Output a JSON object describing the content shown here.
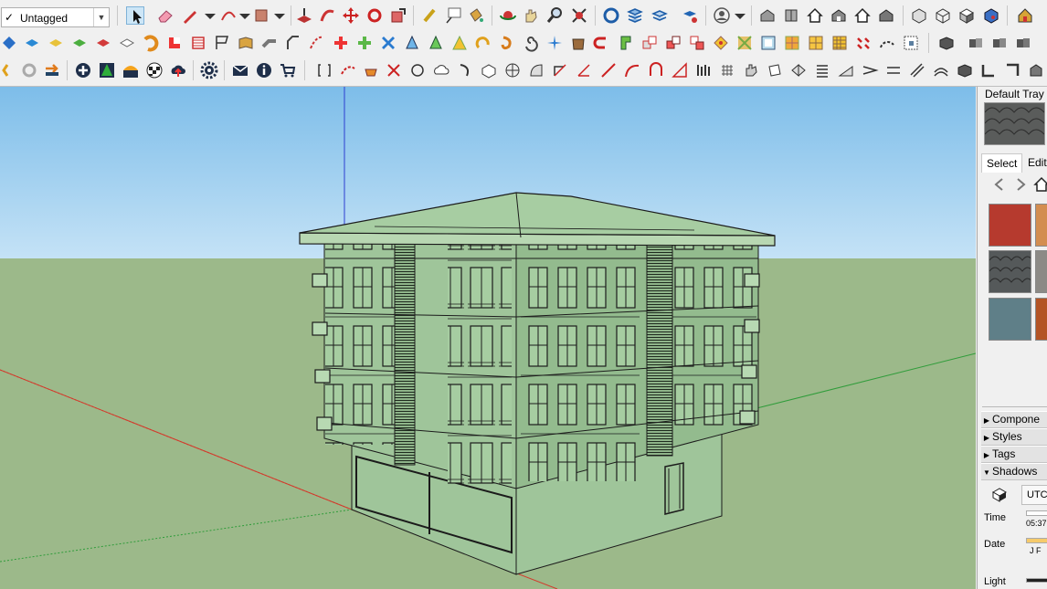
{
  "toolbar": {
    "tag_selector": {
      "checkmark": "✓",
      "value": "Untagged"
    }
  },
  "viewport": {
    "sky_color": "#a9d3ef",
    "ground_color": "#9cb98a",
    "model_color": "#9fc59a",
    "axis_colors": {
      "red": "#d33a2c",
      "green": "#2f9c3a",
      "blue": "#2d3ed0"
    }
  },
  "tray": {
    "title": "Default Tray",
    "tabs": {
      "select": "Select",
      "edit": "Edit"
    },
    "sections": {
      "components": "Compone",
      "styles": "Styles",
      "tags": "Tags",
      "shadows": "Shadows"
    },
    "shadows": {
      "utc": "UTC-",
      "time_label": "Time",
      "time_value": "05:37",
      "date_label": "Date",
      "months": "J F",
      "light_label": "Light"
    }
  }
}
